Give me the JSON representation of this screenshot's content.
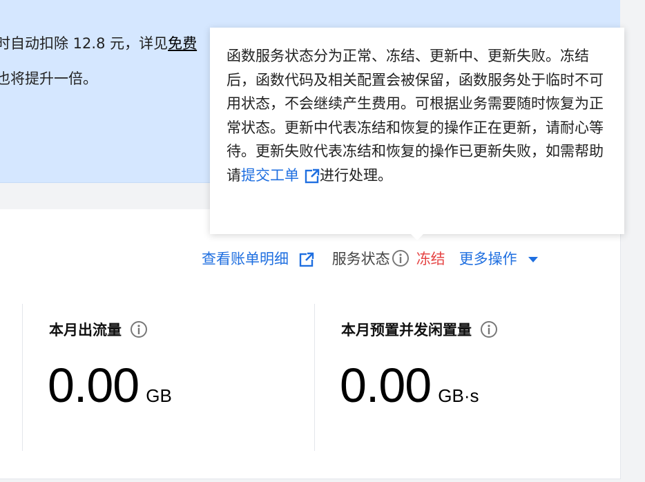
{
  "notice": {
    "line1_prefix": "时自动扣除 12.8 元，详见",
    "line1_link": "免费",
    "line2": "也将提升一倍。"
  },
  "tooltip": {
    "text": "函数服务状态分为正常、冻结、更新中、更新失败。冻结后，函数代码及相关配置会被保留，函数服务处于临时不可用状态，不会继续产生费用。可根据业务需要随时恢复为正常状态。更新中代表冻结和恢复的操作正在更新，请耐心等待。更新失败代表冻结和恢复的操作已更新失败，如需帮助请",
    "link_label": "提交工单",
    "text_after": "进行处理。"
  },
  "actions": {
    "bill_detail_label": "查看账单明细",
    "status_label": "服务状态",
    "status_value": "冻结",
    "more_ops_label": "更多操作"
  },
  "metrics": [
    {
      "title": "本月出流量",
      "value": "0.00",
      "unit": "GB"
    },
    {
      "title": "本月预置并发闲置量",
      "value": "0.00",
      "unit": "GB·s"
    }
  ],
  "colors": {
    "accent": "#1f6fe0",
    "danger": "#e54545",
    "banner": "#d5e7ff"
  },
  "icons": {
    "external": "external-link-icon",
    "info": "info-icon",
    "caret": "caret-down-icon"
  }
}
